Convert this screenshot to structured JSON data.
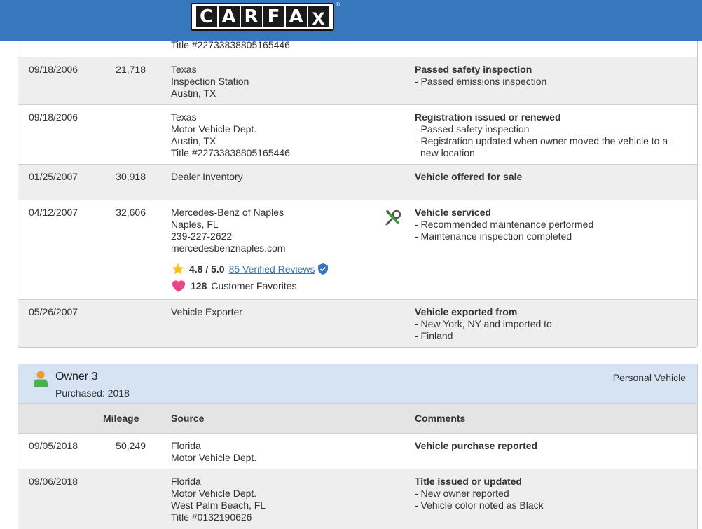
{
  "header": {
    "logo_letters": [
      "C",
      "A",
      "R",
      "F",
      "A",
      "X"
    ],
    "logo_reg": "®"
  },
  "owner2": {
    "top_partial": {
      "source_line": "Title #22733838805165446"
    },
    "records": [
      {
        "date": "09/18/2006",
        "mileage": "21,718",
        "source": [
          "Texas",
          "Inspection Station",
          "Austin, TX"
        ],
        "comment_title": "Passed safety inspection",
        "comment_bullets": [
          "- Passed emissions inspection"
        ]
      },
      {
        "date": "09/18/2006",
        "mileage": "",
        "source": [
          "Texas",
          "Motor Vehicle Dept.",
          "Austin, TX",
          "Title #22733838805165446"
        ],
        "comment_title": "Registration issued or renewed",
        "comment_bullets": [
          "- Passed safety inspection",
          "- Registration updated when owner moved the vehicle to a new location"
        ]
      },
      {
        "date": "01/25/2007",
        "mileage": "30,918",
        "source": [
          "Dealer Inventory"
        ],
        "comment_title": "Vehicle offered for sale",
        "comment_bullets": []
      },
      {
        "date": "04/12/2007",
        "mileage": "32,606",
        "source": [
          "Mercedes-Benz of Naples",
          "Naples, FL",
          "239-227-2622",
          "mercedesbenznaples.com"
        ],
        "rating": "4.8 / 5.0",
        "reviews_link": "85 Verified Reviews",
        "favorites_count": "128",
        "favorites_label": "Customer Favorites",
        "comment_title": "Vehicle serviced",
        "comment_bullets": [
          "- Recommended maintenance performed",
          "- Maintenance inspection completed"
        ]
      },
      {
        "date": "05/26/2007",
        "mileage": "",
        "source": [
          "Vehicle Exporter"
        ],
        "comment_title": "Vehicle exported from",
        "comment_bullets": [
          "- New York, NY and imported to",
          "- Finland"
        ]
      }
    ]
  },
  "owner3": {
    "title": "Owner 3",
    "purchased": "Purchased: 2018",
    "type": "Personal Vehicle",
    "columns": {
      "mileage": "Mileage",
      "source": "Source",
      "comments": "Comments"
    },
    "records": [
      {
        "date": "09/05/2018",
        "mileage": "50,249",
        "source": [
          "Florida",
          "Motor Vehicle Dept."
        ],
        "comment_title": "Vehicle purchase reported",
        "comment_bullets": []
      },
      {
        "date": "09/06/2018",
        "mileage": "",
        "source": [
          "Florida",
          "Motor Vehicle Dept.",
          "West Palm Beach, FL",
          "Title #0132190626"
        ],
        "comment_title": "Title issued or updated",
        "comment_bullets": [
          "- New owner reported",
          "- Vehicle color noted as Black"
        ]
      }
    ]
  },
  "colors": {
    "header_blue": "#3777bc",
    "owner_band": "#d5e3f2",
    "row_gray": "#eeeeee",
    "link": "#3777bc",
    "star": "#f5c518",
    "heart": "#e8468a"
  }
}
